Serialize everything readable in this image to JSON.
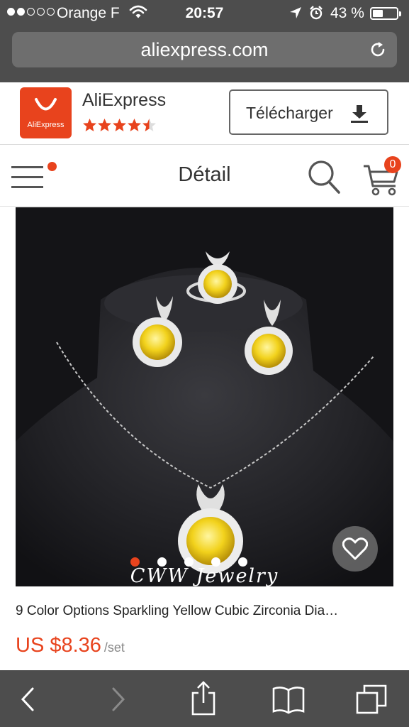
{
  "status_bar": {
    "carrier": "Orange F",
    "time": "20:57",
    "battery_text": "43 %",
    "battery_level": 0.43,
    "signal_bars_filled": 2,
    "signal_bars_total": 5
  },
  "browser": {
    "url": "aliexpress.com"
  },
  "app_banner": {
    "app_name": "AliExpress",
    "logo_text": "AliExpress",
    "rating": 4.5,
    "rating_max": 5,
    "download_label": "Télécharger"
  },
  "header": {
    "title": "Détail",
    "cart_count": "0"
  },
  "product": {
    "watermark": "CWW Jewelry",
    "carousel_total": 5,
    "carousel_active": 1,
    "title": "9 Color Options Sparkling Yellow Cubic Zirconia Dia…",
    "price": "US $8.36",
    "price_unit": "/set"
  },
  "colors": {
    "brand": "#e8431d",
    "ios_bar": "#4d4d4d",
    "gem": "#f2d21c"
  },
  "icons": {
    "wifi": "wifi-icon",
    "location": "location-arrow-icon",
    "alarm": "alarm-icon",
    "reload": "reload-icon",
    "download": "download-icon",
    "menu": "menu-icon",
    "search": "search-icon",
    "cart": "cart-icon",
    "wishlist": "heart-icon",
    "back": "chevron-left-icon",
    "forward": "chevron-right-icon",
    "share": "share-icon",
    "bookmarks": "book-icon",
    "tabs": "tabs-icon"
  }
}
